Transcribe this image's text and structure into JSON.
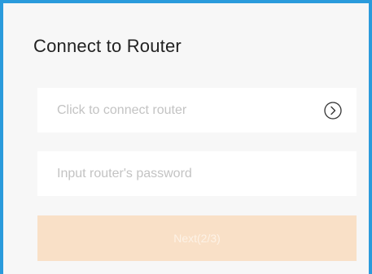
{
  "page": {
    "title": "Connect to Router"
  },
  "router_field": {
    "placeholder": "Click to connect router",
    "icon": "chevron-right-circle-icon"
  },
  "password_field": {
    "placeholder": "Input router's password",
    "value": ""
  },
  "next_button": {
    "label": "Next(2/3)",
    "state": "disabled"
  },
  "colors": {
    "frame_border": "#2a9bdc",
    "background": "#f7f7f7",
    "button_disabled": "#f9e0c7"
  }
}
